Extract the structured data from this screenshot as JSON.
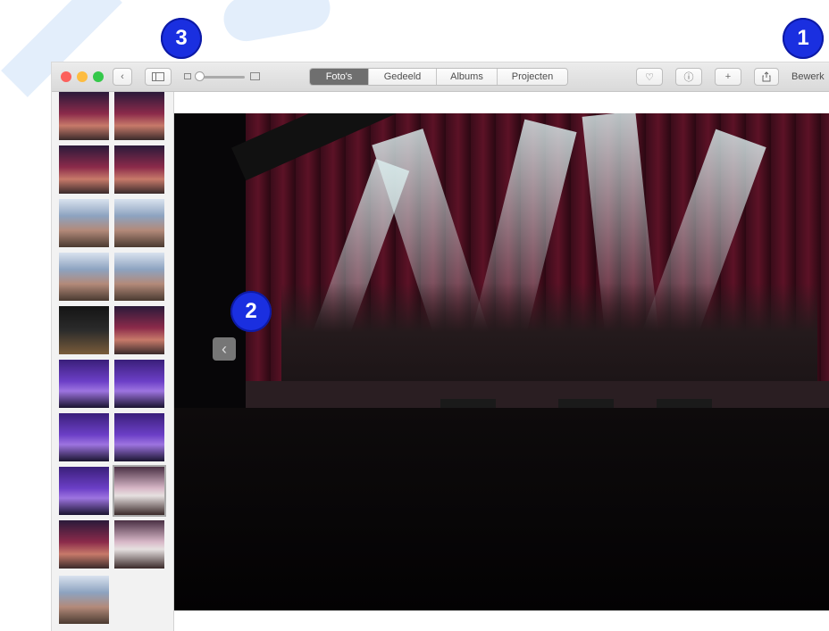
{
  "callouts": {
    "one": "1",
    "two": "2",
    "three": "3"
  },
  "toolbar": {
    "back_icon": "chevron-left-icon",
    "tabs": [
      {
        "label": "Foto's",
        "active": true
      },
      {
        "label": "Gedeeld",
        "active": false
      },
      {
        "label": "Albums",
        "active": false
      },
      {
        "label": "Projecten",
        "active": false
      }
    ],
    "favorite_icon": "heart-icon",
    "info_icon": "info-icon",
    "add_icon": "plus-icon",
    "share_icon": "share-icon",
    "edit_label": "Bewerk"
  },
  "sidebar": {
    "thumbnails": [
      "concert",
      "concert",
      "concert",
      "concert",
      "concert-blue",
      "concert-blue",
      "concert-blue",
      "concert-blue",
      "piano",
      "stage",
      "purple",
      "purple",
      "purple",
      "purple",
      "purple",
      "white",
      "concert",
      "white",
      "crowd"
    ]
  },
  "viewer": {
    "prev_icon": "chevron-left-icon"
  }
}
